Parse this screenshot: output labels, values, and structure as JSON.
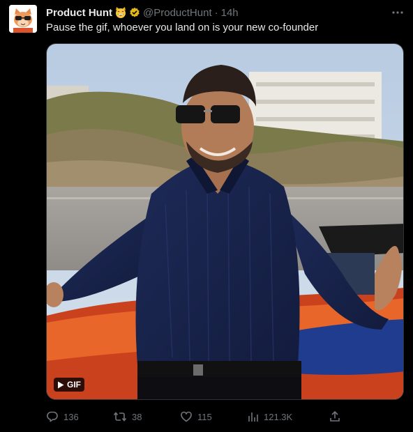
{
  "post": {
    "display_name": "Product Hunt",
    "handle": "@ProductHunt",
    "separator": "·",
    "time": "14h",
    "text": "Pause the gif, whoever you land on is your new co-founder"
  },
  "media": {
    "badge_label": "GIF"
  },
  "actions": {
    "replies": "136",
    "reposts": "38",
    "likes": "115",
    "views": "121.3K"
  },
  "icons": {
    "avatar": "product-hunt-cat-avatar",
    "name_emoji": "grinning-cat-emoji",
    "verified": "gold-verified-badge",
    "more": "more-horizontal-icon",
    "reply": "reply-icon",
    "repost": "repost-icon",
    "like": "heart-icon",
    "views": "views-icon",
    "share": "share-icon",
    "play": "play-icon"
  },
  "colors": {
    "background": "#000000",
    "text": "#e7e9ea",
    "muted": "#71767b",
    "verified_gold": "#e2b719"
  }
}
